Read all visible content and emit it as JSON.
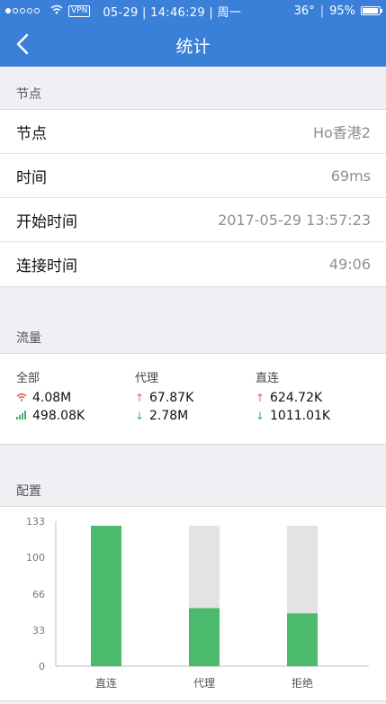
{
  "status_bar": {
    "vpn": "VPN",
    "datetime": "05-29 | 14:46:29 | 周一",
    "temperature": "36°",
    "battery": "95%",
    "battery_level": 0.95
  },
  "nav": {
    "title": "统计"
  },
  "node_section": {
    "header": "节点",
    "rows": [
      {
        "label": "节点",
        "value": "Ho香港2"
      },
      {
        "label": "时间",
        "value": "69ms"
      },
      {
        "label": "开始时间",
        "value": "2017-05-29 13:57:23"
      },
      {
        "label": "连接时间",
        "value": "49:06"
      }
    ]
  },
  "traffic_section": {
    "header": "流量",
    "columns": [
      {
        "title": "全部",
        "upload": "4.08M",
        "download": "498.08K",
        "upload_icon": "wifi-icon",
        "download_icon": "cellular-icon"
      },
      {
        "title": "代理",
        "upload": "67.87K",
        "download": "2.78M",
        "upload_icon": "arrow-up-icon",
        "download_icon": "arrow-down-icon"
      },
      {
        "title": "直连",
        "upload": "624.72K",
        "download": "1011.01K",
        "upload_icon": "arrow-up-icon",
        "download_icon": "arrow-down-icon"
      }
    ]
  },
  "config_section": {
    "header": "配置"
  },
  "chart_data": {
    "type": "bar",
    "categories": [
      "直连",
      "代理",
      "拒绝"
    ],
    "values": [
      133,
      55,
      50
    ],
    "max": 133,
    "yticks": [
      "0",
      "33",
      "66",
      "100",
      "133"
    ],
    "ylim": [
      0,
      133
    ],
    "bar_color": "#4cba6c",
    "track_color": "#e3e3e3"
  },
  "colors": {
    "accent": "#3b80d8",
    "up": "#e06a5a",
    "down": "#45b36a"
  }
}
